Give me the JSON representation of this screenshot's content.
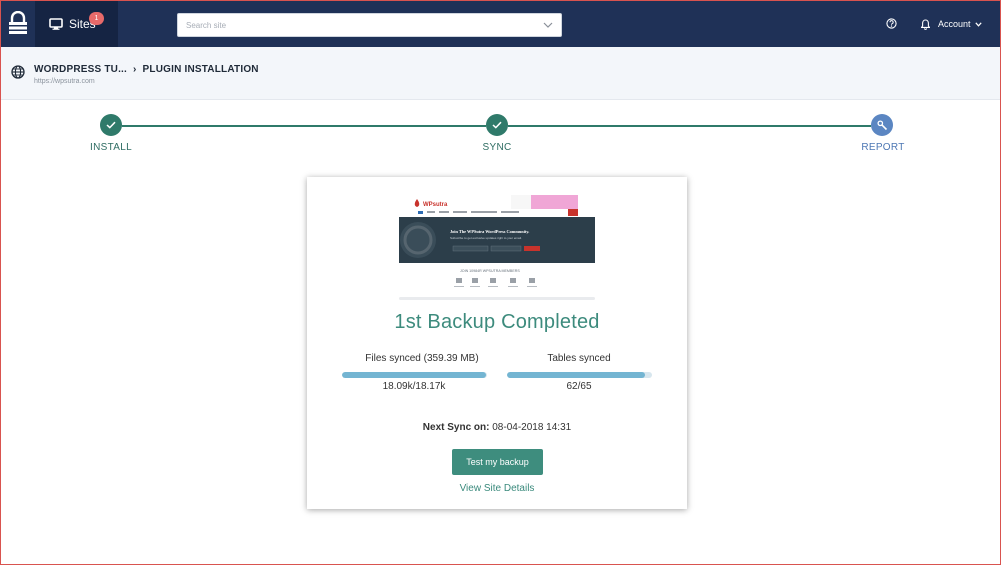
{
  "header": {
    "sites_label": "Sites",
    "sites_badge": "1",
    "search_placeholder": "Search site",
    "account_label": "Account",
    "colors": {
      "bar": "#1f3157",
      "active_tab": "#152443",
      "badge": "#e76a6a"
    }
  },
  "breadcrumb": {
    "site_name": "WORDPRESS TU...",
    "separator": "›",
    "page": "PLUGIN INSTALLATION",
    "url": "https://wpsutra.com"
  },
  "stepper": {
    "steps": [
      {
        "label": "INSTALL",
        "state": "done",
        "icon": "check-icon"
      },
      {
        "label": "SYNC",
        "state": "done",
        "icon": "check-icon"
      },
      {
        "label": "REPORT",
        "state": "current",
        "icon": "wrench-icon"
      }
    ],
    "colors": {
      "done": "#2f7a6a",
      "current": "#5b86c2"
    }
  },
  "site_preview": {
    "logo_text": "WPsutra",
    "banner_title": "Join The WPSutra WordPress Community.",
    "banner_subtitle": "Subscribe to get exclusive updates right to your email.",
    "join_text": "JOIN 10984R WPSUTRA MEMBERS"
  },
  "card": {
    "headline": "1st Backup Completed",
    "files": {
      "label": "Files synced (359.39 MB)",
      "value": "18.09k/18.17k",
      "progress": 0.9956
    },
    "tables": {
      "label": "Tables synced",
      "value": "62/65",
      "progress": 0.9538
    },
    "next_sync_label": "Next Sync on:",
    "next_sync_value": "08-04-2018 14:31",
    "test_button": "Test my backup",
    "details_link": "View Site Details",
    "colors": {
      "accent": "#3e8d7e",
      "progress": "#74b5d2"
    }
  }
}
